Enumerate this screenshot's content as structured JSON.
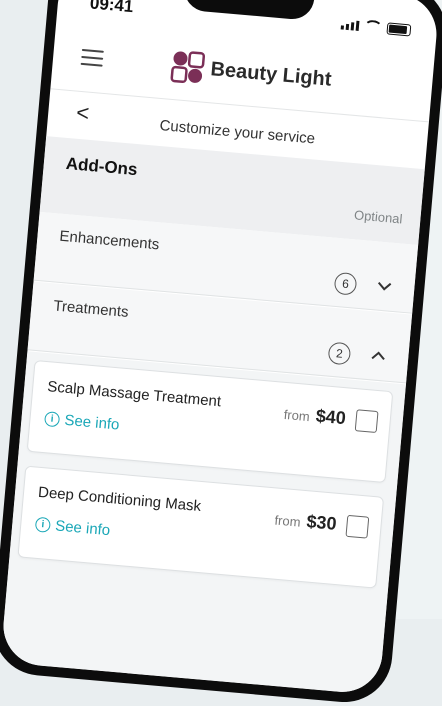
{
  "status": {
    "time": "09:41"
  },
  "header": {
    "brand": "Beauty Light"
  },
  "subheader": {
    "back": "<",
    "title": "Customize your service"
  },
  "addons": {
    "title": "Add-Ons",
    "optional": "Optional"
  },
  "sections": [
    {
      "title": "Enhancements",
      "count": "6",
      "expanded": false
    },
    {
      "title": "Treatments",
      "count": "2",
      "expanded": true
    }
  ],
  "items": [
    {
      "name": "Scalp Massage Treatment",
      "from": "from",
      "price": "$40",
      "info": "See info"
    },
    {
      "name": "Deep Conditioning Mask",
      "from": "from",
      "price": "$30",
      "info": "See info"
    }
  ],
  "colors": {
    "accent": "#1aa7b7",
    "brand": "#7b2f57"
  }
}
